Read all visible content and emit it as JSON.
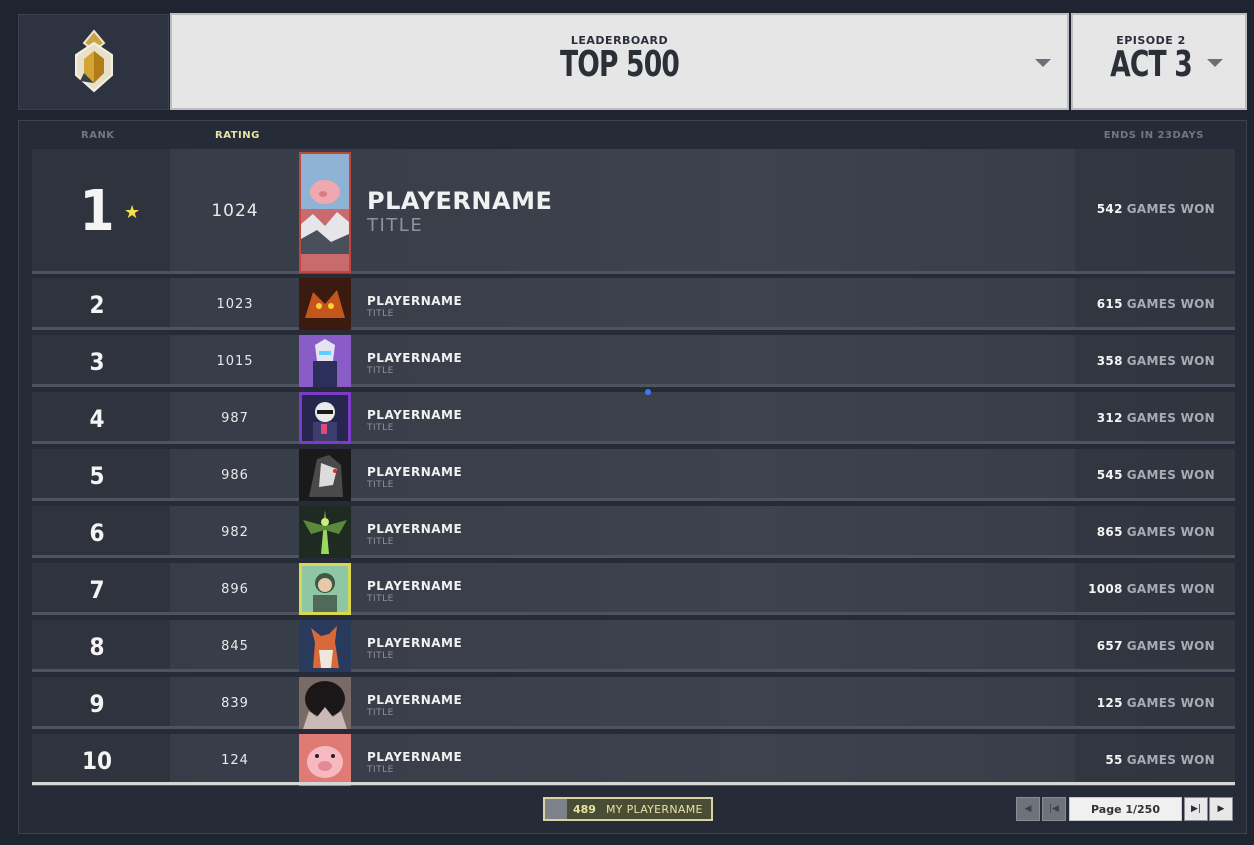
{
  "header": {
    "board_label": "LEADERBOARD",
    "board_value": "TOP 500",
    "episode_label": "EPISODE 2",
    "act_value": "ACT 3"
  },
  "columns": {
    "rank": "RANK",
    "rating": "RATING",
    "ends": "ENDS IN 23DAYS"
  },
  "rows": [
    {
      "rank": "1",
      "rating": "1024",
      "name": "PLAYERNAME",
      "title": "TITLE",
      "games": "542",
      "games_suffix": "GAMES WON",
      "avatar_color": "#d76a6f"
    },
    {
      "rank": "2",
      "rating": "1023",
      "name": "PLAYERNAME",
      "title": "TITLE",
      "games": "615",
      "games_suffix": "GAMES WON",
      "avatar_color": "#6b2c16"
    },
    {
      "rank": "3",
      "rating": "1015",
      "name": "PLAYERNAME",
      "title": "TITLE",
      "games": "358",
      "games_suffix": "GAMES WON",
      "avatar_color": "#6b4a9e"
    },
    {
      "rank": "4",
      "rating": "987",
      "name": "PLAYERNAME",
      "title": "TITLE",
      "games": "312",
      "games_suffix": "GAMES WON",
      "avatar_color": "#2a2f6e"
    },
    {
      "rank": "5",
      "rating": "986",
      "name": "PLAYERNAME",
      "title": "TITLE",
      "games": "545",
      "games_suffix": "GAMES WON",
      "avatar_color": "#2b2b2b"
    },
    {
      "rank": "6",
      "rating": "982",
      "name": "PLAYERNAME",
      "title": "TITLE",
      "games": "865",
      "games_suffix": "GAMES WON",
      "avatar_color": "#3f6a3a"
    },
    {
      "rank": "7",
      "rating": "896",
      "name": "PLAYERNAME",
      "title": "TITLE",
      "games": "1008",
      "games_suffix": "GAMES WON",
      "avatar_color": "#c4c24a"
    },
    {
      "rank": "8",
      "rating": "845",
      "name": "PLAYERNAME",
      "title": "TITLE",
      "games": "657",
      "games_suffix": "GAMES WON",
      "avatar_color": "#2c4468"
    },
    {
      "rank": "9",
      "rating": "839",
      "name": "PLAYERNAME",
      "title": "TITLE",
      "games": "125",
      "games_suffix": "GAMES WON",
      "avatar_color": "#5a4b48"
    },
    {
      "rank": "10",
      "rating": "124",
      "name": "PLAYERNAME",
      "title": "TITLE",
      "games": "55",
      "games_suffix": "GAMES WON",
      "avatar_color": "#e0787a"
    }
  ],
  "footer": {
    "my_rank": "489",
    "my_name": "MY PLAYERNAME",
    "page_text": "Page 1/250"
  },
  "colors": {
    "accent_rating": "#e9e3a3",
    "star": "#f3e14a",
    "first_avatar_border": "#c4463a"
  },
  "icons": {
    "logo": "radiant-rank-icon",
    "first_place": "star-icon",
    "dropdown": "chevron-down-icon",
    "page_prev": "caret-left-icon",
    "page_first": "first-page-icon",
    "page_last": "last-page-icon",
    "page_next": "caret-right-icon"
  }
}
